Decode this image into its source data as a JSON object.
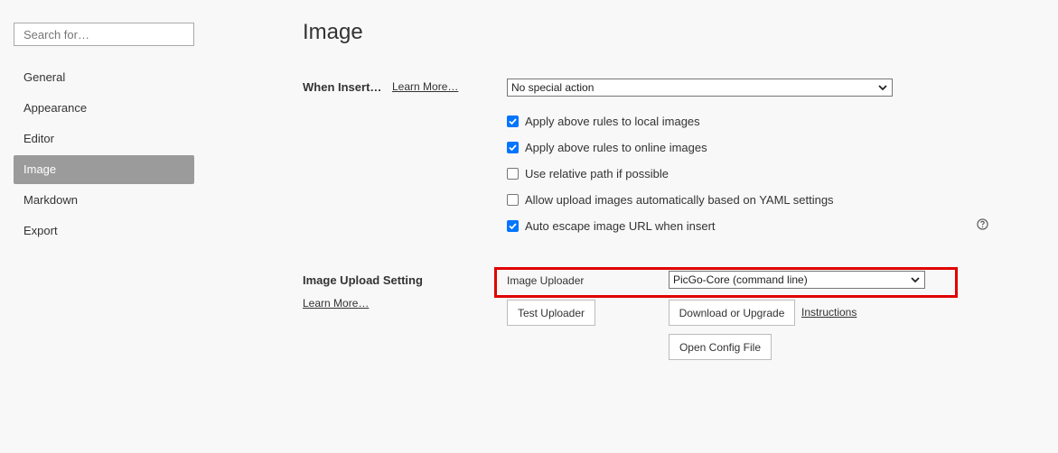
{
  "sidebar": {
    "search_placeholder": "Search for…",
    "items": [
      {
        "label": "General"
      },
      {
        "label": "Appearance"
      },
      {
        "label": "Editor"
      },
      {
        "label": "Image"
      },
      {
        "label": "Markdown"
      },
      {
        "label": "Export"
      }
    ],
    "active_index": 3
  },
  "main": {
    "title": "Image",
    "when_insert": {
      "label": "When Insert…",
      "learn_more": "Learn More…",
      "select_value": "No special action",
      "options": [
        {
          "label": "Apply above rules to local images",
          "checked": true
        },
        {
          "label": "Apply above rules to online images",
          "checked": true
        },
        {
          "label": "Use relative path if possible",
          "checked": false
        },
        {
          "label": "Allow upload images automatically based on YAML settings",
          "checked": false
        },
        {
          "label": "Auto escape image URL when insert",
          "checked": true
        }
      ]
    },
    "upload": {
      "label": "Image Upload Setting",
      "learn_more": "Learn More…",
      "uploader_label": "Image Uploader",
      "uploader_value": "PicGo-Core (command line)",
      "test_button": "Test Uploader",
      "download_button": "Download or Upgrade",
      "instructions_link": "Instructions",
      "open_config_button": "Open Config File"
    }
  },
  "colors": {
    "accent": "#0075ff",
    "active_nav": "#9b9b9b",
    "highlight": "#e00000"
  }
}
